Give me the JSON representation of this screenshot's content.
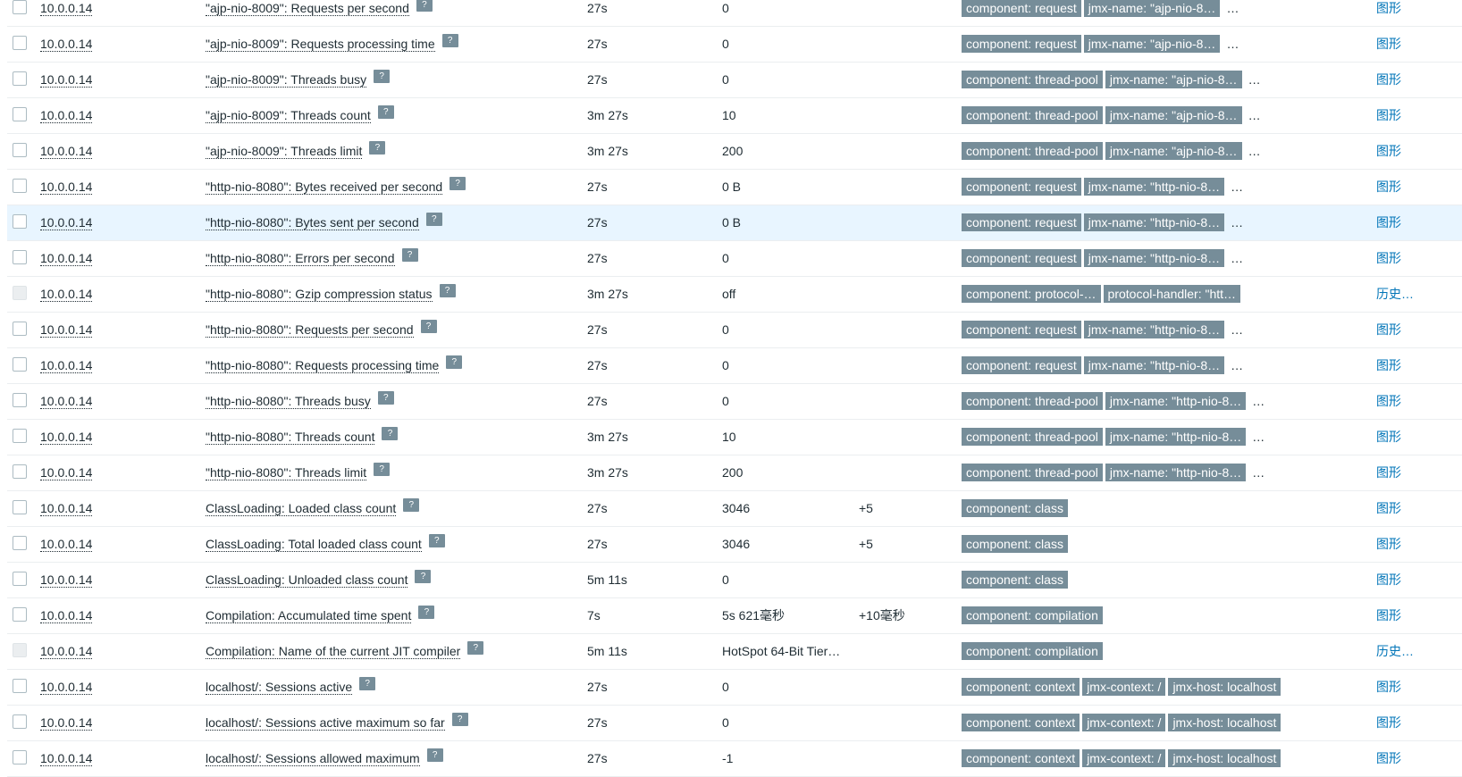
{
  "rows": [
    {
      "host": "10.0.0.14",
      "name": "\"ajp-nio-8009\": Requests per second",
      "interval": "27s",
      "value": "0",
      "change": "",
      "tags": [
        "component: request",
        "jmx-name: \"ajp-nio-8…"
      ],
      "more": "…",
      "link": "图形",
      "hl": false,
      "disabled": false
    },
    {
      "host": "10.0.0.14",
      "name": "\"ajp-nio-8009\": Requests processing time",
      "interval": "27s",
      "value": "0",
      "change": "",
      "tags": [
        "component: request",
        "jmx-name: \"ajp-nio-8…"
      ],
      "more": "…",
      "link": "图形",
      "hl": false,
      "disabled": false
    },
    {
      "host": "10.0.0.14",
      "name": "\"ajp-nio-8009\": Threads busy",
      "interval": "27s",
      "value": "0",
      "change": "",
      "tags": [
        "component: thread-pool",
        "jmx-name: \"ajp-nio-8…"
      ],
      "more": "…",
      "link": "图形",
      "hl": false,
      "disabled": false
    },
    {
      "host": "10.0.0.14",
      "name": "\"ajp-nio-8009\": Threads count",
      "interval": "3m 27s",
      "value": "10",
      "change": "",
      "tags": [
        "component: thread-pool",
        "jmx-name: \"ajp-nio-8…"
      ],
      "more": "…",
      "link": "图形",
      "hl": false,
      "disabled": false
    },
    {
      "host": "10.0.0.14",
      "name": "\"ajp-nio-8009\": Threads limit",
      "interval": "3m 27s",
      "value": "200",
      "change": "",
      "tags": [
        "component: thread-pool",
        "jmx-name: \"ajp-nio-8…"
      ],
      "more": "…",
      "link": "图形",
      "hl": false,
      "disabled": false
    },
    {
      "host": "10.0.0.14",
      "name": "\"http-nio-8080\": Bytes received per second",
      "interval": "27s",
      "value": "0 B",
      "change": "",
      "tags": [
        "component: request",
        "jmx-name: \"http-nio-8…"
      ],
      "more": "…",
      "link": "图形",
      "hl": false,
      "disabled": false
    },
    {
      "host": "10.0.0.14",
      "name": "\"http-nio-8080\": Bytes sent per second",
      "interval": "27s",
      "value": "0 B",
      "change": "",
      "tags": [
        "component: request",
        "jmx-name: \"http-nio-8…"
      ],
      "more": "…",
      "link": "图形",
      "hl": true,
      "disabled": false
    },
    {
      "host": "10.0.0.14",
      "name": "\"http-nio-8080\": Errors per second",
      "interval": "27s",
      "value": "0",
      "change": "",
      "tags": [
        "component: request",
        "jmx-name: \"http-nio-8…"
      ],
      "more": "…",
      "link": "图形",
      "hl": false,
      "disabled": false
    },
    {
      "host": "10.0.0.14",
      "name": "\"http-nio-8080\": Gzip compression status",
      "interval": "3m 27s",
      "value": "off",
      "change": "",
      "tags": [
        "component: protocol-…",
        "protocol-handler: \"htt…"
      ],
      "more": "",
      "link": "历史…",
      "hl": false,
      "disabled": true
    },
    {
      "host": "10.0.0.14",
      "name": "\"http-nio-8080\": Requests per second",
      "interval": "27s",
      "value": "0",
      "change": "",
      "tags": [
        "component: request",
        "jmx-name: \"http-nio-8…"
      ],
      "more": "…",
      "link": "图形",
      "hl": false,
      "disabled": false
    },
    {
      "host": "10.0.0.14",
      "name": "\"http-nio-8080\": Requests processing time",
      "interval": "27s",
      "value": "0",
      "change": "",
      "tags": [
        "component: request",
        "jmx-name: \"http-nio-8…"
      ],
      "more": "…",
      "link": "图形",
      "hl": false,
      "disabled": false
    },
    {
      "host": "10.0.0.14",
      "name": "\"http-nio-8080\": Threads busy",
      "interval": "27s",
      "value": "0",
      "change": "",
      "tags": [
        "component: thread-pool",
        "jmx-name: \"http-nio-8…"
      ],
      "more": "…",
      "link": "图形",
      "hl": false,
      "disabled": false
    },
    {
      "host": "10.0.0.14",
      "name": "\"http-nio-8080\": Threads count",
      "interval": "3m 27s",
      "value": "10",
      "change": "",
      "tags": [
        "component: thread-pool",
        "jmx-name: \"http-nio-8…"
      ],
      "more": "…",
      "link": "图形",
      "hl": false,
      "disabled": false
    },
    {
      "host": "10.0.0.14",
      "name": "\"http-nio-8080\": Threads limit",
      "interval": "3m 27s",
      "value": "200",
      "change": "",
      "tags": [
        "component: thread-pool",
        "jmx-name: \"http-nio-8…"
      ],
      "more": "…",
      "link": "图形",
      "hl": false,
      "disabled": false
    },
    {
      "host": "10.0.0.14",
      "name": "ClassLoading: Loaded class count",
      "interval": "27s",
      "value": "3046",
      "change": "+5",
      "tags": [
        "component: class"
      ],
      "more": "",
      "link": "图形",
      "hl": false,
      "disabled": false
    },
    {
      "host": "10.0.0.14",
      "name": "ClassLoading: Total loaded class count",
      "interval": "27s",
      "value": "3046",
      "change": "+5",
      "tags": [
        "component: class"
      ],
      "more": "",
      "link": "图形",
      "hl": false,
      "disabled": false
    },
    {
      "host": "10.0.0.14",
      "name": "ClassLoading: Unloaded class count",
      "interval": "5m 11s",
      "value": "0",
      "change": "",
      "tags": [
        "component: class"
      ],
      "more": "",
      "link": "图形",
      "hl": false,
      "disabled": false
    },
    {
      "host": "10.0.0.14",
      "name": "Compilation: Accumulated time spent",
      "interval": "7s",
      "value": "5s 621毫秒",
      "change": "+10毫秒",
      "tags": [
        "component: compilation"
      ],
      "more": "",
      "link": "图形",
      "hl": false,
      "disabled": false
    },
    {
      "host": "10.0.0.14",
      "name": "Compilation: Name of the current JIT compiler",
      "interval": "5m 11s",
      "value": "HotSpot 64-Bit Tier…",
      "change": "",
      "tags": [
        "component: compilation"
      ],
      "more": "",
      "link": "历史…",
      "hl": false,
      "disabled": true
    },
    {
      "host": "10.0.0.14",
      "name": "localhost/: Sessions active",
      "interval": "27s",
      "value": "0",
      "change": "",
      "tags": [
        "component: context",
        "jmx-context: /",
        "jmx-host: localhost"
      ],
      "more": "",
      "link": "图形",
      "hl": false,
      "disabled": false
    },
    {
      "host": "10.0.0.14",
      "name": "localhost/: Sessions active maximum so far",
      "interval": "27s",
      "value": "0",
      "change": "",
      "tags": [
        "component: context",
        "jmx-context: /",
        "jmx-host: localhost"
      ],
      "more": "",
      "link": "图形",
      "hl": false,
      "disabled": false
    },
    {
      "host": "10.0.0.14",
      "name": "localhost/: Sessions allowed maximum",
      "interval": "27s",
      "value": "-1",
      "change": "",
      "tags": [
        "component: context",
        "jmx-context: /",
        "jmx-host: localhost"
      ],
      "more": "",
      "link": "图形",
      "hl": false,
      "disabled": false
    }
  ],
  "hint_glyph": "?"
}
